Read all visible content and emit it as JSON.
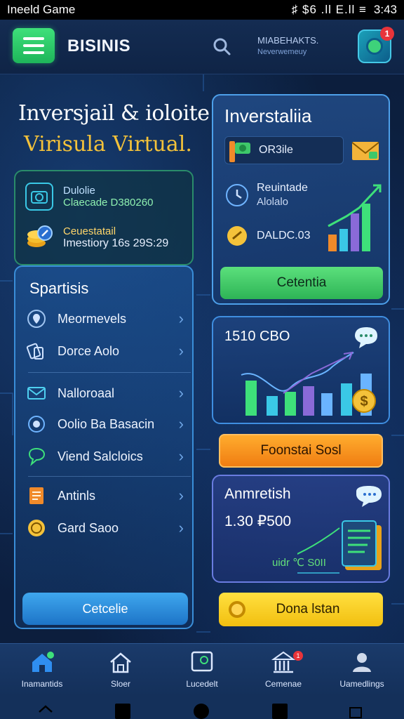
{
  "status_bar": {
    "left": "Ineeld Game",
    "icons": "♯ $6 .ll E.ll ≡",
    "time": "3:43"
  },
  "header": {
    "title": "BISINIS",
    "sub_line1": "MIABEHAKTS.",
    "sub_line2": "Neverwemeuy",
    "notification_count": "1"
  },
  "hero": {
    "title": "Inversjail & ioloite",
    "subtitle": "Virisula Virtual."
  },
  "info_card": {
    "row1_label": "Dulolie",
    "row1_value": "Claecade D380260",
    "row2_label": "Ceuestatail",
    "row2_value": "Imestiory 16s 29S:29"
  },
  "menu": {
    "heading": "Spartisis",
    "items": [
      {
        "label": "Meormevels",
        "icon": "location-pin-icon"
      },
      {
        "label": "Dorce Aolo",
        "icon": "document-stack-icon"
      },
      {
        "label": "Nalloroaal",
        "icon": "mail-icon"
      },
      {
        "label": "Oolio Ba Basacin",
        "icon": "target-icon"
      },
      {
        "label": "Viend Salcloics",
        "icon": "chat-bubble-icon"
      },
      {
        "label": "Antinls",
        "icon": "notepad-icon"
      },
      {
        "label": "Gard Saoo",
        "icon": "coin-icon"
      }
    ],
    "button_label": "Cetcelie"
  },
  "invest_card": {
    "title": "Inverstaliia",
    "input_value": "OR3ile",
    "row1_line1": "Reuintade",
    "row1_line2": "Alolalo",
    "row2_value": "DALDC.03",
    "button_label": "Cetentia"
  },
  "stats_card": {
    "title": "1510 CBO"
  },
  "orange_button": {
    "label": "Foonstai Sosl"
  },
  "amortish_card": {
    "title": "Anmretish",
    "value": "1.30 ₽500",
    "footer": "uidr ℃ S0II"
  },
  "yellow_button": {
    "label": "Dona lstan"
  },
  "bottom_nav": {
    "items": [
      {
        "label": "Inamantids",
        "icon": "home-icon"
      },
      {
        "label": "Sloer",
        "icon": "store-icon"
      },
      {
        "label": "Lucedelt",
        "icon": "tablet-icon"
      },
      {
        "label": "Cemenae",
        "icon": "bank-icon"
      },
      {
        "label": "Uamedlings",
        "icon": "user-icon"
      }
    ],
    "badge": "1"
  },
  "colors": {
    "accent_green": "#2eb456",
    "accent_orange": "#f07d12",
    "accent_yellow": "#f2bf10",
    "accent_blue": "#1d74c7",
    "hero_subtitle": "#f4c23a"
  }
}
